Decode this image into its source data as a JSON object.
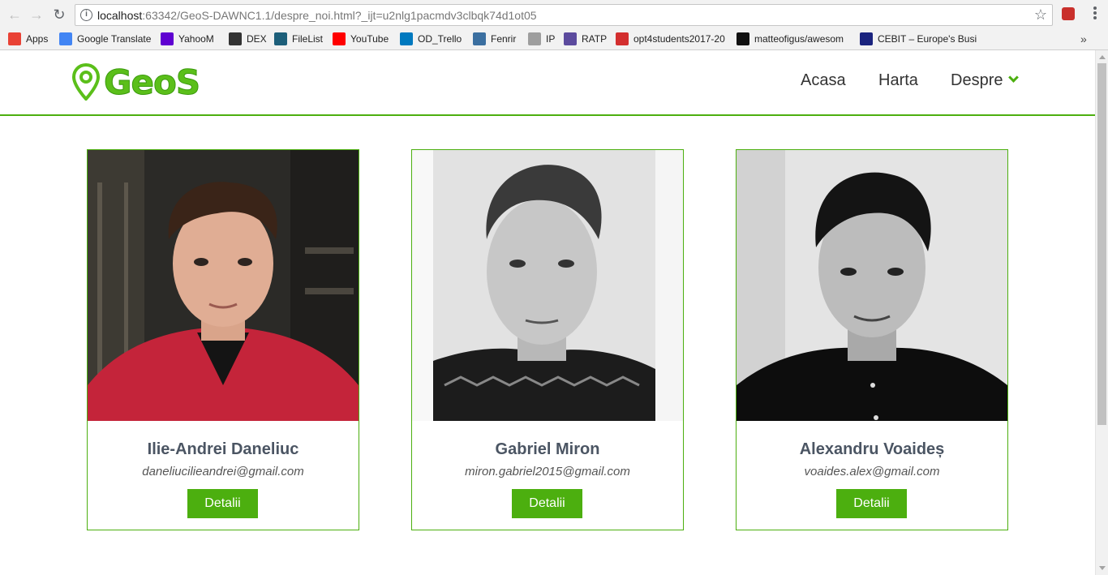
{
  "browser": {
    "url_host": "localhost",
    "url_rest": ":63342/GeoS-DAWNC1.1/despre_noi.html?_ijt=u2nlg1pacmdv3clbqk74d1ot05",
    "bookmarks": [
      {
        "label": "Apps",
        "icon": "apps-grid-icon",
        "color": "#e94235"
      },
      {
        "label": "Google Translate",
        "icon": "google-translate-icon",
        "color": "#4285f4"
      },
      {
        "label": "YahooM",
        "icon": "yahoo-icon",
        "color": "#5f01d1"
      },
      {
        "label": "DEX",
        "icon": "dex-icon",
        "color": "#333333"
      },
      {
        "label": "FileList",
        "icon": "filelist-icon",
        "color": "#1d5f7a"
      },
      {
        "label": "YouTube",
        "icon": "youtube-icon",
        "color": "#ff0000"
      },
      {
        "label": "OD_Trello",
        "icon": "trello-icon",
        "color": "#0079bf"
      },
      {
        "label": "Fenrir",
        "icon": "fenrir-icon",
        "color": "#3b6fa0"
      },
      {
        "label": "IP",
        "icon": "page-icon",
        "color": "#9e9e9e"
      },
      {
        "label": "RATP",
        "icon": "ratp-icon",
        "color": "#5c4b9e"
      },
      {
        "label": "opt4students2017-20",
        "icon": "pdf-icon",
        "color": "#d32f2f"
      },
      {
        "label": "matteofigus/awesom",
        "icon": "github-icon",
        "color": "#111111"
      },
      {
        "label": "CEBIT – Europe's Busi",
        "icon": "cebit-icon",
        "color": "#1a237e"
      }
    ],
    "more_label": "»"
  },
  "site": {
    "logo_text": "GeoS",
    "brand_color": "#4caf0f",
    "nav": [
      {
        "label": "Acasa"
      },
      {
        "label": "Harta"
      },
      {
        "label": "Despre"
      }
    ]
  },
  "team": [
    {
      "name": "Ilie-Andrei Daneliuc",
      "email": "daneliucilieandrei@gmail.com",
      "button": "Detalii"
    },
    {
      "name": "Gabriel Miron",
      "email": "miron.gabriel2015@gmail.com",
      "button": "Detalii"
    },
    {
      "name": "Alexandru Voaideș",
      "email": "voaides.alex@gmail.com",
      "button": "Detalii"
    }
  ]
}
